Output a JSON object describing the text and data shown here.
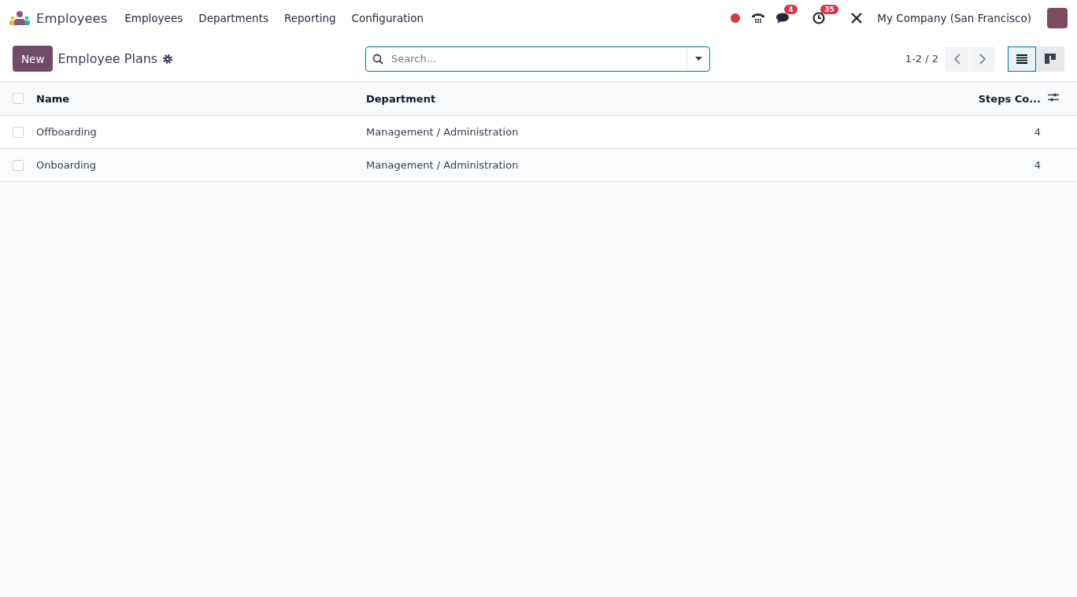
{
  "navbar": {
    "app_name": "Employees",
    "menu": [
      "Employees",
      "Departments",
      "Reporting",
      "Configuration"
    ],
    "messages_badge": "4",
    "activities_badge": "35",
    "company": "My Company (San Francisco)"
  },
  "control_panel": {
    "new_button": "New",
    "title": "Employee Plans",
    "search": {
      "placeholder": "Search..."
    },
    "pager": "1-2 / 2",
    "views": [
      {
        "kind": "list",
        "selected": true
      },
      {
        "kind": "kanban",
        "selected": false
      }
    ]
  },
  "table": {
    "select_all": {
      "checked": false
    },
    "columns": [
      "Name",
      "Department",
      "Steps Co..."
    ],
    "rows": [
      {
        "checked": false,
        "cells": [
          "Offboarding",
          "Management / Administration",
          "4"
        ]
      },
      {
        "checked": false,
        "cells": [
          "Onboarding",
          "Management / Administration",
          "4"
        ]
      }
    ]
  }
}
